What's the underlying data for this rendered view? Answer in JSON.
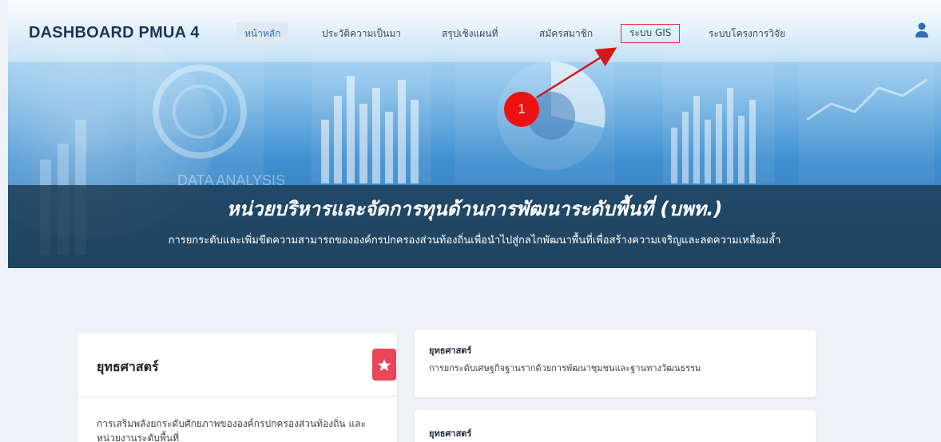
{
  "brand": "DASHBOARD PMUA 4",
  "nav": {
    "items": [
      {
        "label": "หน้าหลัก"
      },
      {
        "label": "ประวัติความเป็นมา"
      },
      {
        "label": "สรุปเชิงแผนที่"
      },
      {
        "label": "สมัครสมาชิก"
      },
      {
        "label": "ระบบ GIS"
      },
      {
        "label": "ระบบโครงการวิจัย"
      }
    ]
  },
  "hero": {
    "watermark": "DATA ANALYSIS",
    "title": "หน่วยบริหารและจัดการทุนด้านการพัฒนาระดับพื้นที่ (บพท.)",
    "subtitle": "การยกระดับและเพิ่มขีดความสามารถขององค์กรปกครองส่วนท้องถิ่นเพื่อนำไปสู่กลไกพัฒนาพื้นที่เพื่อสร้างความเจริญและลดความเหลื่อมล้ำ"
  },
  "strategy_card": {
    "title": "ยุทธศาสตร์",
    "body": "การเสริมพลังยกระดับศักยภาพขององค์กรปกครองส่วนท้องถิ่น และหน่วยงานระดับพื้นที่"
  },
  "strategy_items": [
    {
      "title": "ยุทธศาสตร์",
      "body": "การยกระดับเศษฐกิจฐานรากด้วยการพัฒนาชุมชนและฐานทางวัฒนธรรม"
    },
    {
      "title": "ยุทธศาสตร์",
      "body": ""
    }
  ],
  "annotation": {
    "number": "1"
  },
  "colors": {
    "accent": "#2e6fb5",
    "highlight": "#d9344a",
    "badge": "#e9465a",
    "annotation": "#ee1111"
  }
}
